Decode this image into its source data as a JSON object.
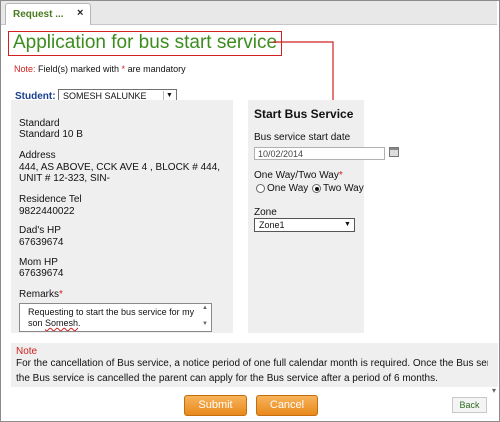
{
  "tab": {
    "label": "Request ...",
    "close": "×"
  },
  "page_title": "Application for bus start service",
  "top_note": {
    "label": "Note:",
    "text_a": " Field(s) marked with ",
    "star": "*",
    "text_b": " are mandatory"
  },
  "student": {
    "label": "Student:",
    "selected": "SOMESH SALUNKE"
  },
  "info": {
    "standard_label": "Standard",
    "standard_value": "Standard 10 B",
    "address_label": "Address",
    "address_line1": "444, AS ABOVE, CCK AVE 4 , BLOCK # 444,",
    "address_line2": "UNIT # 12-323, SIN-",
    "residence_label": "Residence Tel",
    "residence_value": "9822440022",
    "dad_label": "Dad's HP",
    "dad_value": "67639674",
    "mom_label": "Mom HP",
    "mom_value": "67639674",
    "remarks_label": "Remarks",
    "required_star": "*",
    "remarks_text_a": "Requesting to start the bus service for my son ",
    "remarks_text_name": "Somesh",
    "remarks_text_b": "."
  },
  "start_bus": {
    "heading": "Start Bus Service",
    "date_label": "Bus service start date",
    "date_value": "10/02/2014",
    "way_label": "One Way/Two Way",
    "way_star": "*",
    "one_way": "One Way",
    "two_way": "Two Way",
    "selected_way": "Two Way",
    "zone_label": "Zone",
    "zone_value": "Zone1"
  },
  "bottom_note": {
    "title": "Note",
    "line1": "For the cancellation of Bus service, a notice period of one full calendar month is required. Once the Bus service is",
    "line2": "the Bus service is  cancelled the parent can apply for the Bus service after a period of 6 months."
  },
  "buttons": {
    "submit": "Submit",
    "cancel": "Cancel",
    "back": "Back"
  },
  "colors": {
    "title_green": "#3c8c1e",
    "annotation_red": "#d02020",
    "button_orange": "#f0a040",
    "label_blue": "#1a3f8f"
  }
}
